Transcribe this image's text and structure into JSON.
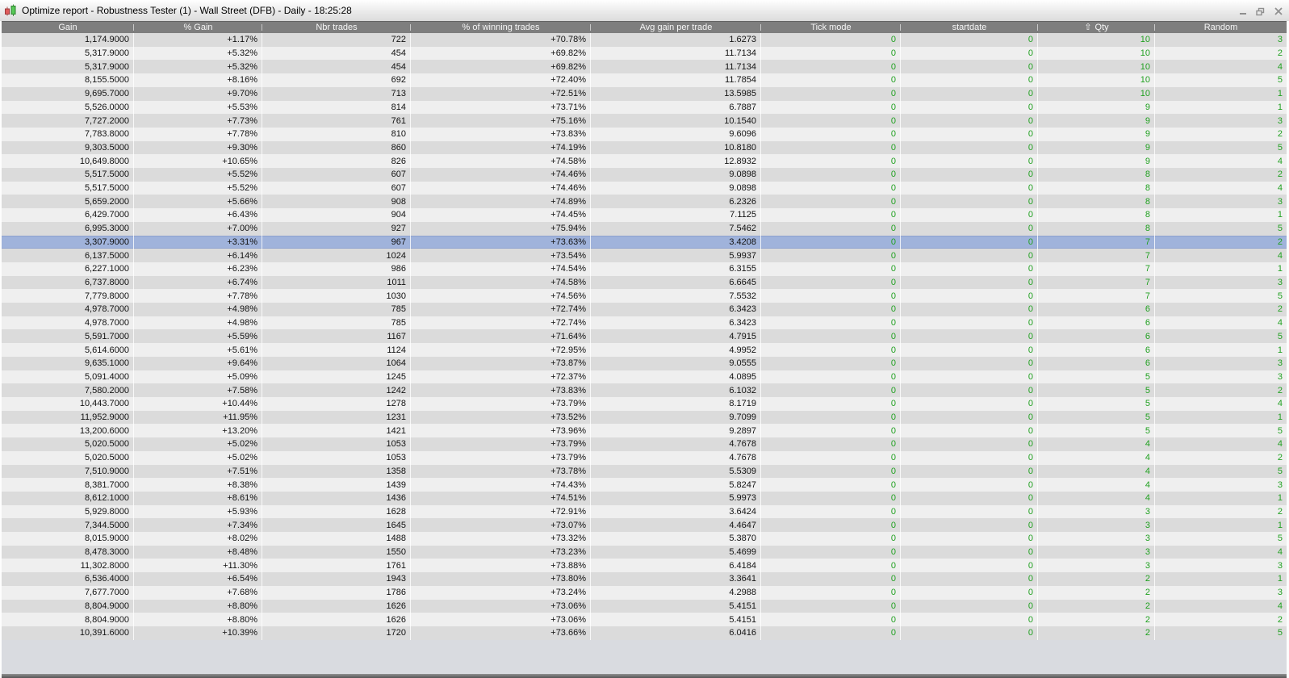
{
  "window": {
    "title": "Optimize report - Robustness Tester (1) - Wall Street (DFB) - Daily - 18:25:28"
  },
  "icons": {
    "app_icon": "candlestick-chart",
    "sort_ascending": "⇧"
  },
  "colors": {
    "header_bg": "#7e7e7e",
    "row_odd": "#dbdbdb",
    "row_even": "#efefef",
    "selected_row": "#a0b3db",
    "value_green": "#21a121",
    "filler": "#d9dbe0"
  },
  "table": {
    "selected_row_index": 15,
    "columns": [
      {
        "key": "gain",
        "label": "Gain",
        "green": false,
        "sorted": null
      },
      {
        "key": "pct-gain",
        "label": "% Gain",
        "green": false,
        "sorted": null
      },
      {
        "key": "nbr-trades",
        "label": "Nbr trades",
        "green": false,
        "sorted": null
      },
      {
        "key": "pct-winning",
        "label": "% of winning trades",
        "green": false,
        "sorted": null
      },
      {
        "key": "avg-gain",
        "label": "Avg gain per trade",
        "green": false,
        "sorted": null
      },
      {
        "key": "tick-mode",
        "label": "Tick mode",
        "green": true,
        "sorted": null
      },
      {
        "key": "startdate",
        "label": "startdate",
        "green": true,
        "sorted": null
      },
      {
        "key": "qty",
        "label": "Qty",
        "green": true,
        "sorted": "asc"
      },
      {
        "key": "random",
        "label": "Random",
        "green": true,
        "sorted": null
      }
    ],
    "rows": [
      [
        "1,174.9000",
        "+1.17%",
        "722",
        "+70.78%",
        "1.6273",
        "0",
        "0",
        "10",
        "3"
      ],
      [
        "5,317.9000",
        "+5.32%",
        "454",
        "+69.82%",
        "11.7134",
        "0",
        "0",
        "10",
        "2"
      ],
      [
        "5,317.9000",
        "+5.32%",
        "454",
        "+69.82%",
        "11.7134",
        "0",
        "0",
        "10",
        "4"
      ],
      [
        "8,155.5000",
        "+8.16%",
        "692",
        "+72.40%",
        "11.7854",
        "0",
        "0",
        "10",
        "5"
      ],
      [
        "9,695.7000",
        "+9.70%",
        "713",
        "+72.51%",
        "13.5985",
        "0",
        "0",
        "10",
        "1"
      ],
      [
        "5,526.0000",
        "+5.53%",
        "814",
        "+73.71%",
        "6.7887",
        "0",
        "0",
        "9",
        "1"
      ],
      [
        "7,727.2000",
        "+7.73%",
        "761",
        "+75.16%",
        "10.1540",
        "0",
        "0",
        "9",
        "3"
      ],
      [
        "7,783.8000",
        "+7.78%",
        "810",
        "+73.83%",
        "9.6096",
        "0",
        "0",
        "9",
        "2"
      ],
      [
        "9,303.5000",
        "+9.30%",
        "860",
        "+74.19%",
        "10.8180",
        "0",
        "0",
        "9",
        "5"
      ],
      [
        "10,649.8000",
        "+10.65%",
        "826",
        "+74.58%",
        "12.8932",
        "0",
        "0",
        "9",
        "4"
      ],
      [
        "5,517.5000",
        "+5.52%",
        "607",
        "+74.46%",
        "9.0898",
        "0",
        "0",
        "8",
        "2"
      ],
      [
        "5,517.5000",
        "+5.52%",
        "607",
        "+74.46%",
        "9.0898",
        "0",
        "0",
        "8",
        "4"
      ],
      [
        "5,659.2000",
        "+5.66%",
        "908",
        "+74.89%",
        "6.2326",
        "0",
        "0",
        "8",
        "3"
      ],
      [
        "6,429.7000",
        "+6.43%",
        "904",
        "+74.45%",
        "7.1125",
        "0",
        "0",
        "8",
        "1"
      ],
      [
        "6,995.3000",
        "+7.00%",
        "927",
        "+75.94%",
        "7.5462",
        "0",
        "0",
        "8",
        "5"
      ],
      [
        "3,307.9000",
        "+3.31%",
        "967",
        "+73.63%",
        "3.4208",
        "0",
        "0",
        "7",
        "2"
      ],
      [
        "6,137.5000",
        "+6.14%",
        "1024",
        "+73.54%",
        "5.9937",
        "0",
        "0",
        "7",
        "4"
      ],
      [
        "6,227.1000",
        "+6.23%",
        "986",
        "+74.54%",
        "6.3155",
        "0",
        "0",
        "7",
        "1"
      ],
      [
        "6,737.8000",
        "+6.74%",
        "1011",
        "+74.58%",
        "6.6645",
        "0",
        "0",
        "7",
        "3"
      ],
      [
        "7,779.8000",
        "+7.78%",
        "1030",
        "+74.56%",
        "7.5532",
        "0",
        "0",
        "7",
        "5"
      ],
      [
        "4,978.7000",
        "+4.98%",
        "785",
        "+72.74%",
        "6.3423",
        "0",
        "0",
        "6",
        "2"
      ],
      [
        "4,978.7000",
        "+4.98%",
        "785",
        "+72.74%",
        "6.3423",
        "0",
        "0",
        "6",
        "4"
      ],
      [
        "5,591.7000",
        "+5.59%",
        "1167",
        "+71.64%",
        "4.7915",
        "0",
        "0",
        "6",
        "5"
      ],
      [
        "5,614.6000",
        "+5.61%",
        "1124",
        "+72.95%",
        "4.9952",
        "0",
        "0",
        "6",
        "1"
      ],
      [
        "9,635.1000",
        "+9.64%",
        "1064",
        "+73.87%",
        "9.0555",
        "0",
        "0",
        "6",
        "3"
      ],
      [
        "5,091.4000",
        "+5.09%",
        "1245",
        "+72.37%",
        "4.0895",
        "0",
        "0",
        "5",
        "3"
      ],
      [
        "7,580.2000",
        "+7.58%",
        "1242",
        "+73.83%",
        "6.1032",
        "0",
        "0",
        "5",
        "2"
      ],
      [
        "10,443.7000",
        "+10.44%",
        "1278",
        "+73.79%",
        "8.1719",
        "0",
        "0",
        "5",
        "4"
      ],
      [
        "11,952.9000",
        "+11.95%",
        "1231",
        "+73.52%",
        "9.7099",
        "0",
        "0",
        "5",
        "1"
      ],
      [
        "13,200.6000",
        "+13.20%",
        "1421",
        "+73.96%",
        "9.2897",
        "0",
        "0",
        "5",
        "5"
      ],
      [
        "5,020.5000",
        "+5.02%",
        "1053",
        "+73.79%",
        "4.7678",
        "0",
        "0",
        "4",
        "4"
      ],
      [
        "5,020.5000",
        "+5.02%",
        "1053",
        "+73.79%",
        "4.7678",
        "0",
        "0",
        "4",
        "2"
      ],
      [
        "7,510.9000",
        "+7.51%",
        "1358",
        "+73.78%",
        "5.5309",
        "0",
        "0",
        "4",
        "5"
      ],
      [
        "8,381.7000",
        "+8.38%",
        "1439",
        "+74.43%",
        "5.8247",
        "0",
        "0",
        "4",
        "3"
      ],
      [
        "8,612.1000",
        "+8.61%",
        "1436",
        "+74.51%",
        "5.9973",
        "0",
        "0",
        "4",
        "1"
      ],
      [
        "5,929.8000",
        "+5.93%",
        "1628",
        "+72.91%",
        "3.6424",
        "0",
        "0",
        "3",
        "2"
      ],
      [
        "7,344.5000",
        "+7.34%",
        "1645",
        "+73.07%",
        "4.4647",
        "0",
        "0",
        "3",
        "1"
      ],
      [
        "8,015.9000",
        "+8.02%",
        "1488",
        "+73.32%",
        "5.3870",
        "0",
        "0",
        "3",
        "5"
      ],
      [
        "8,478.3000",
        "+8.48%",
        "1550",
        "+73.23%",
        "5.4699",
        "0",
        "0",
        "3",
        "4"
      ],
      [
        "11,302.8000",
        "+11.30%",
        "1761",
        "+73.88%",
        "6.4184",
        "0",
        "0",
        "3",
        "3"
      ],
      [
        "6,536.4000",
        "+6.54%",
        "1943",
        "+73.80%",
        "3.3641",
        "0",
        "0",
        "2",
        "1"
      ],
      [
        "7,677.7000",
        "+7.68%",
        "1786",
        "+73.24%",
        "4.2988",
        "0",
        "0",
        "2",
        "3"
      ],
      [
        "8,804.9000",
        "+8.80%",
        "1626",
        "+73.06%",
        "5.4151",
        "0",
        "0",
        "2",
        "4"
      ],
      [
        "8,804.9000",
        "+8.80%",
        "1626",
        "+73.06%",
        "5.4151",
        "0",
        "0",
        "2",
        "2"
      ],
      [
        "10,391.6000",
        "+10.39%",
        "1720",
        "+73.66%",
        "6.0416",
        "0",
        "0",
        "2",
        "5"
      ]
    ]
  }
}
